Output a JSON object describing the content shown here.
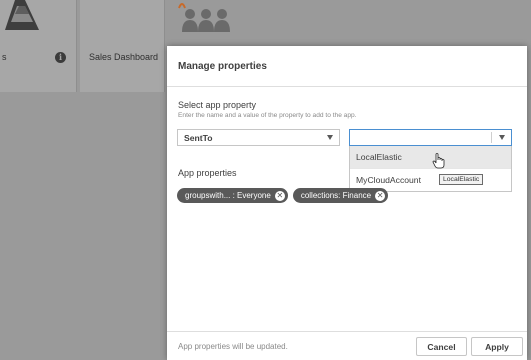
{
  "background": {
    "cards": [
      {
        "label": "s",
        "info_icon": "i"
      },
      {
        "label": "Sales Dashboard"
      }
    ]
  },
  "dialog": {
    "title": "Manage properties",
    "select_section": {
      "title": "Select app property",
      "description": "Enter the name and a value of the property to add to the app.",
      "property_select": {
        "value": "SentTo"
      },
      "value_select": {
        "value": ""
      },
      "dropdown_options": [
        "LocalElastic",
        "MyCloudAccount"
      ],
      "hovered_option": "LocalElastic",
      "tooltip": "LocalElastic"
    },
    "app_properties": {
      "title": "App properties",
      "chips": [
        {
          "label": "groupswith... : Everyone"
        },
        {
          "label": "collections: Finance"
        }
      ]
    },
    "footer": {
      "note": "App properties will be updated.",
      "cancel_label": "Cancel",
      "apply_label": "Apply"
    }
  },
  "colors": {
    "overlay": "#9a9a9a",
    "chip": "#595959",
    "focus_border": "#4a8fd1"
  }
}
